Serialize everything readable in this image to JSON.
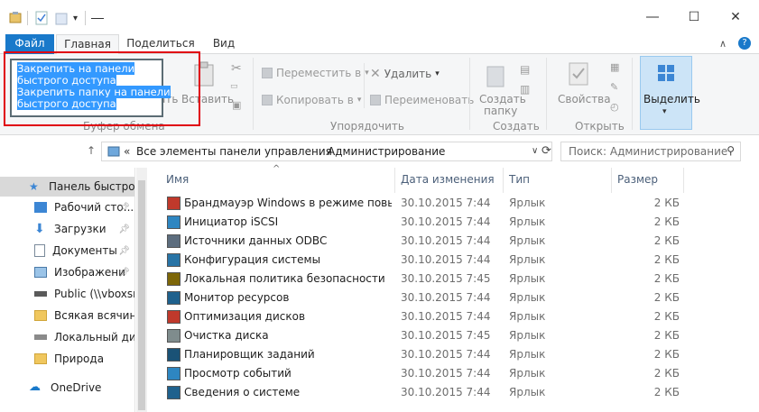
{
  "ribbon_tabs": {
    "file": "Файл",
    "home": "Главная",
    "share": "Поделиться",
    "view": "Вид"
  },
  "tooltip": {
    "lines": [
      "Закрепить на панели",
      "быстрого доступа",
      "Закрепить папку на панели",
      "быстрого доступа"
    ]
  },
  "ribbon": {
    "clipboard": {
      "paste_partial": "ать",
      "paste": "Вставить",
      "group_label": "Буфер обмена"
    },
    "organize": {
      "move_to": "Переместить в",
      "copy_to": "Копировать в",
      "delete": "Удалить",
      "rename": "Переименовать",
      "group_label": "Упорядочить"
    },
    "new": {
      "new_folder_line1": "Создать",
      "new_folder_line2": "папку",
      "group_label": "Создать"
    },
    "open": {
      "properties": "Свойства",
      "group_label": "Открыть"
    },
    "select": {
      "select": "Выделить"
    }
  },
  "address": {
    "chevrons": "«",
    "path": [
      "Все элементы панели управления",
      "Администрирование"
    ],
    "search_placeholder": "Поиск: Администрирование"
  },
  "nav": {
    "items": [
      {
        "label": "Панель быстрого",
        "pinned": false
      },
      {
        "label": "Рабочий сто...",
        "pinned": true
      },
      {
        "label": "Загрузки",
        "pinned": true
      },
      {
        "label": "Документы",
        "pinned": true
      },
      {
        "label": "Изображени",
        "pinned": true
      },
      {
        "label": "Public (\\\\vboxsrv",
        "pinned": false
      },
      {
        "label": "Всякая всячина",
        "pinned": false
      },
      {
        "label": "Локальный дис",
        "pinned": false
      },
      {
        "label": "Природа",
        "pinned": false
      },
      {
        "label": "OneDrive",
        "pinned": false
      }
    ]
  },
  "list": {
    "columns": {
      "name": "Имя",
      "date": "Дата изменения",
      "type": "Тип",
      "size": "Размер"
    },
    "rows": [
      {
        "name": "Брандмауэр Windows в режиме повы...",
        "date": "30.10.2015 7:44",
        "type": "Ярлык",
        "size": "2 КБ"
      },
      {
        "name": "Инициатор iSCSI",
        "date": "30.10.2015 7:44",
        "type": "Ярлык",
        "size": "2 КБ"
      },
      {
        "name": "Источники данных ODBC",
        "date": "30.10.2015 7:44",
        "type": "Ярлык",
        "size": "2 КБ"
      },
      {
        "name": "Конфигурация системы",
        "date": "30.10.2015 7:44",
        "type": "Ярлык",
        "size": "2 КБ"
      },
      {
        "name": "Локальная политика безопасности",
        "date": "30.10.2015 7:45",
        "type": "Ярлык",
        "size": "2 КБ"
      },
      {
        "name": "Монитор ресурсов",
        "date": "30.10.2015 7:44",
        "type": "Ярлык",
        "size": "2 КБ"
      },
      {
        "name": "Оптимизация дисков",
        "date": "30.10.2015 7:44",
        "type": "Ярлык",
        "size": "2 КБ"
      },
      {
        "name": "Очистка диска",
        "date": "30.10.2015 7:45",
        "type": "Ярлык",
        "size": "2 КБ"
      },
      {
        "name": "Планировщик заданий",
        "date": "30.10.2015 7:44",
        "type": "Ярлык",
        "size": "2 КБ"
      },
      {
        "name": "Просмотр событий",
        "date": "30.10.2015 7:44",
        "type": "Ярлык",
        "size": "2 КБ"
      },
      {
        "name": "Сведения о системе",
        "date": "30.10.2015 7:44",
        "type": "Ярлык",
        "size": "2 КБ"
      }
    ]
  },
  "colors": {
    "file_tab": "#1979ca",
    "selection": "#3399ff",
    "highlight_border": "#e0000f"
  }
}
